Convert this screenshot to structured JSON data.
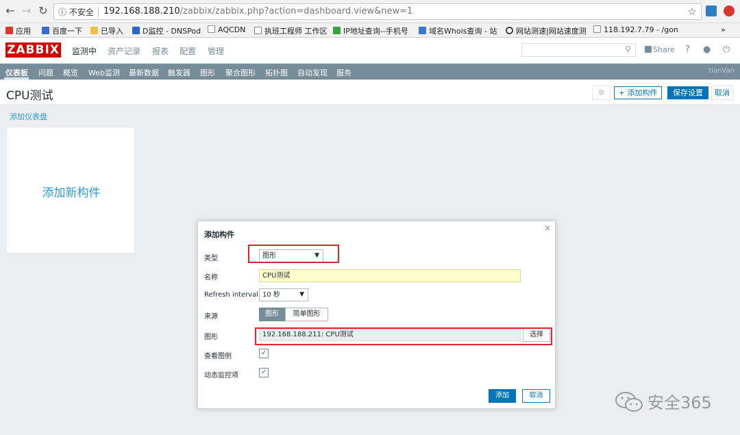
{
  "browser": {
    "security_label": "不安全",
    "url_host": "192.168.188.210",
    "url_path": "/zabbix/zabbix.php?action=dashboard.view&new=1",
    "bookmarks": [
      {
        "label": "应用",
        "color": "#d9362e"
      },
      {
        "label": "百度一下",
        "color": "#3868d6"
      },
      {
        "label": "已导入",
        "color": "#f0c040"
      },
      {
        "label": "D监控 - DNSPod",
        "color": "#2e64c8"
      },
      {
        "label": "AQCDN",
        "color": "#888888"
      },
      {
        "label": "执班工程师 工作区",
        "color": "#888888"
      },
      {
        "label": "IP地址查询--手机号",
        "color": "#3aa040"
      },
      {
        "label": "域名Whois查询 - 站",
        "color": "#3a7ad0"
      },
      {
        "label": "网站测速|网站速度测",
        "color": "#444444"
      },
      {
        "label": "118.192.7.79 - /gon",
        "color": "#888888"
      }
    ],
    "more": "»"
  },
  "header": {
    "logo": "ZABBIX",
    "menu": [
      "监测中",
      "资产记录",
      "报表",
      "配置",
      "管理"
    ],
    "share": "Share",
    "help": "?"
  },
  "submenu": {
    "items": [
      "仪表板",
      "问题",
      "概览",
      "Web监测",
      "最新数据",
      "触发器",
      "图形",
      "聚合图形",
      "拓扑图",
      "自动发现",
      "服务"
    ],
    "user": "tianVan"
  },
  "page": {
    "title": "CPU测试",
    "add_widget": "+ 添加构件",
    "save": "保存设置",
    "cancel": "取消",
    "add_dashboard": "添加仪表盘",
    "placeholder": "添加新构件"
  },
  "dialog": {
    "title": "添加构件",
    "close": "×",
    "type_label": "类型",
    "type_value": "图形",
    "name_label": "名称",
    "name_value": "CPU测试",
    "refresh_label": "Refresh interval",
    "refresh_value": "10 秒",
    "source_label": "来源",
    "source_options": [
      "图形",
      "简单图形"
    ],
    "graph_label": "图形",
    "graph_value": "192.168.188.211: CPU测试",
    "choose": "选择",
    "legend_label": "查看图例",
    "dynamic_label": "动态监控项",
    "add": "添加",
    "cancel": "取消"
  },
  "watermark": {
    "text": "安全365"
  }
}
